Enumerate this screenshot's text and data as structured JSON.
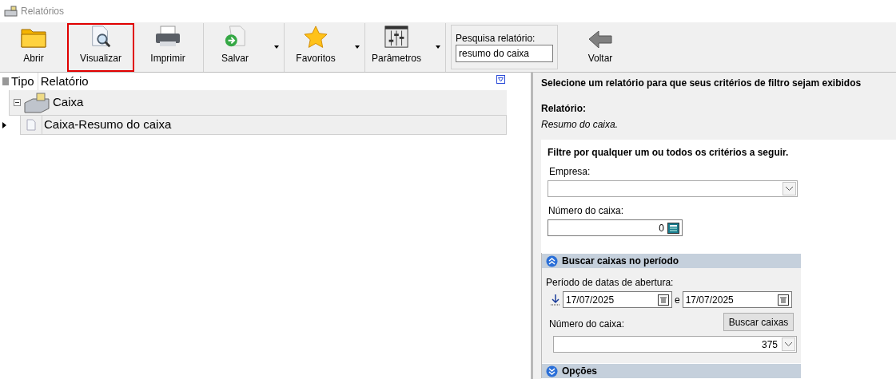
{
  "window": {
    "title": "Relatórios"
  },
  "toolbar": {
    "buttons": [
      {
        "label": "Abrir",
        "kind": "button",
        "selected": false
      },
      {
        "label": "Visualizar",
        "kind": "button",
        "selected": true
      },
      {
        "label": "Imprimir",
        "kind": "button",
        "selected": false
      },
      {
        "label": "Salvar",
        "kind": "dropdown",
        "selected": false
      },
      {
        "label": "Favoritos",
        "kind": "dropdown",
        "selected": false
      },
      {
        "label": "Parâmetros",
        "kind": "dropdown",
        "selected": false
      }
    ],
    "search": {
      "label": "Pesquisa relatório:",
      "value": "resumo do caixa"
    },
    "back": {
      "label": "Voltar"
    }
  },
  "tree": {
    "columns": [
      "Tipo",
      "Relatório"
    ],
    "groups": [
      {
        "label": "Caixa",
        "expanded": true,
        "children": [
          {
            "label": "Caixa-Resumo do caixa",
            "selected": true
          }
        ]
      }
    ]
  },
  "details": {
    "heading": "Selecione um relatório para que seus critérios de filtro sejam exibidos",
    "report_label": "Relatório:",
    "report_name": "Resumo do caixa.",
    "filter": {
      "heading": "Filtre por qualquer um ou todos os critérios a seguir.",
      "company": {
        "label": "Empresa:"
      },
      "cash_number": {
        "label": "Número do caixa:",
        "value": "0"
      },
      "sections": [
        {
          "title": "Buscar caixas no período",
          "expanded": true,
          "period_label": "Período de datas de abertura:",
          "date_from": "17/07/2025",
          "separator": "e",
          "date_to": "17/07/2025",
          "button": "Buscar caixas",
          "cash_label": "Número do caixa:",
          "cash_value": "375"
        },
        {
          "title": "Opções",
          "expanded": false
        }
      ]
    }
  }
}
